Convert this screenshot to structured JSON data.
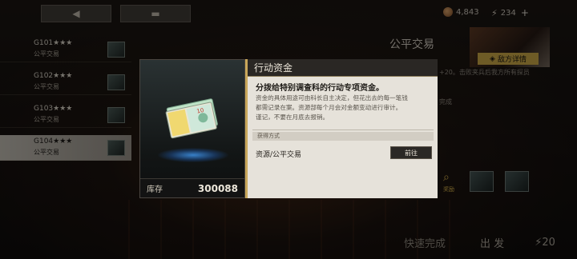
{
  "topbar": {
    "back_icon": "◀",
    "home_icon": "▬",
    "currency1_value": "4,843",
    "currency2_value": "234",
    "plus_label": "+"
  },
  "list": {
    "items": [
      {
        "code": "G101★★★",
        "sub": "公平交易"
      },
      {
        "code": "G102★★★",
        "sub": "公平交易"
      },
      {
        "code": "G103★★★",
        "sub": "公平交易"
      },
      {
        "code": "G104★★★",
        "sub": "公平交易"
      }
    ]
  },
  "right": {
    "title": "公平交易",
    "enemy_btn_label": "敌方详情",
    "text1": "+20。击败夹兵后我方所有探员",
    "text2": "完成",
    "reward_label": "奖励",
    "quick_complete_label": "快速完成",
    "depart_label": "出 发",
    "energy_cost": "20"
  },
  "modal": {
    "title": "行动资金",
    "desc_title": "分拨给特别调查科的行动专项资金。",
    "desc_lines": [
      "资金的具体用途可由科长自主决定，但花出去的每一笔钱",
      "都需记录在案。资源部每个月会对金额变动进行审计。",
      "谨记，不要在月底去报销。"
    ],
    "source_header": "获得方式",
    "source_text": "资源/公平交易",
    "goto_label": "前往",
    "stock_label": "库存",
    "stock_value": "300088"
  },
  "colors": {
    "accent_gold": "#c9a75a",
    "panel_light": "#e6e2da",
    "panel_dark": "#2a2724"
  }
}
